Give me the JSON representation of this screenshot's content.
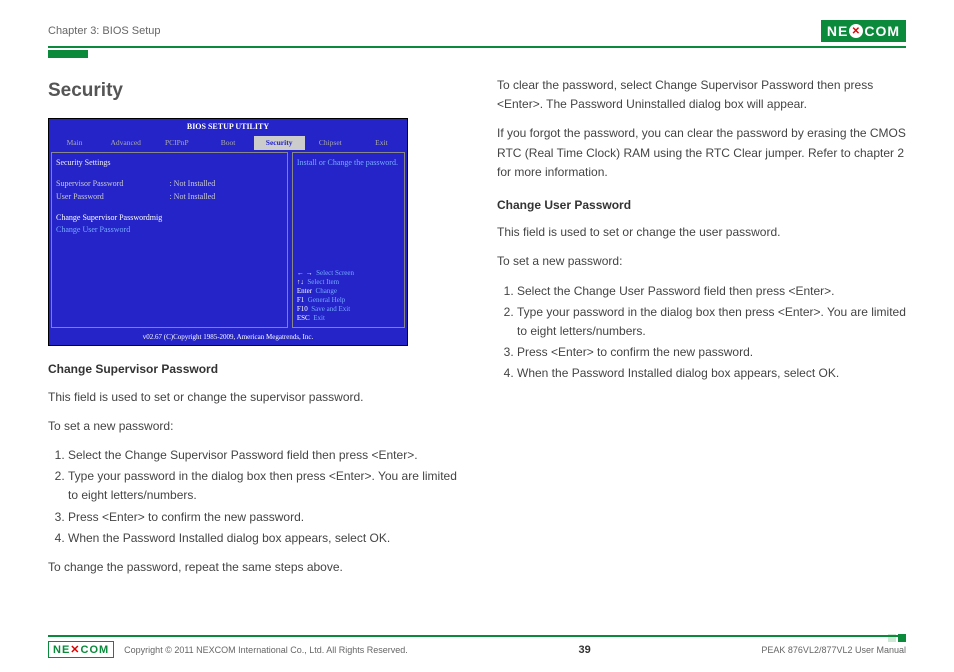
{
  "header": {
    "chapter": "Chapter 3: BIOS Setup",
    "brand": "NEXCOM"
  },
  "section_title": "Security",
  "bios": {
    "title": "BIOS SETUP UTILITY",
    "tabs": [
      "Main",
      "Advanced",
      "PCIPnP",
      "Boot",
      "Security",
      "Chipset",
      "Exit"
    ],
    "active_tab": "Security",
    "group": "Security Settings",
    "rows": [
      {
        "label": "Supervisor Password",
        "value": ": Not Installed"
      },
      {
        "label": "User Password",
        "value": ": Not Installed"
      }
    ],
    "change_sup": "Change Supervisor Passwordmig",
    "change_user": "Change User Password",
    "help": "Install or Change the password.",
    "keys": [
      {
        "k": "← →",
        "d": "Select Screen"
      },
      {
        "k": "↑↓",
        "d": "Select Item"
      },
      {
        "k": "Enter",
        "d": "Change"
      },
      {
        "k": "F1",
        "d": "General Help"
      },
      {
        "k": "F10",
        "d": "Save and Exit"
      },
      {
        "k": "ESC",
        "d": "Exit"
      }
    ],
    "footer": "v02.67 (C)Copyright 1985-2009, American Megatrends, Inc."
  },
  "left": {
    "h1": "Change Supervisor Password",
    "p1": "This field is used to set or change the supervisor password.",
    "p2": "To set a new password:",
    "steps": [
      "Select the Change Supervisor Password field then press <Enter>.",
      "Type your password in the dialog box then press <Enter>. You are limited to eight letters/numbers.",
      "Press <Enter> to confirm the new password.",
      "When the Password Installed dialog box appears, select OK."
    ],
    "p3": "To change the password, repeat the same steps above."
  },
  "right": {
    "p1": "To clear the password, select Change Supervisor Password then press <Enter>. The Password Uninstalled dialog box will appear.",
    "p2": "If you forgot the password, you can clear the password by erasing the CMOS RTC (Real Time Clock) RAM using the RTC Clear jumper. Refer to chapter 2 for more information.",
    "h1": "Change User Password",
    "p3": "This field is used to set or change the user password.",
    "p4": "To set a new password:",
    "steps": [
      "Select the Change User Password field then press <Enter>.",
      "Type your password in the dialog box then press <Enter>. You are limited to eight letters/numbers.",
      "Press <Enter> to confirm the new password.",
      "When the Password Installed dialog box appears, select OK."
    ]
  },
  "footer": {
    "copyright": "Copyright © 2011 NEXCOM International Co., Ltd. All Rights Reserved.",
    "page": "39",
    "manual": "PEAK 876VL2/877VL2 User Manual"
  }
}
